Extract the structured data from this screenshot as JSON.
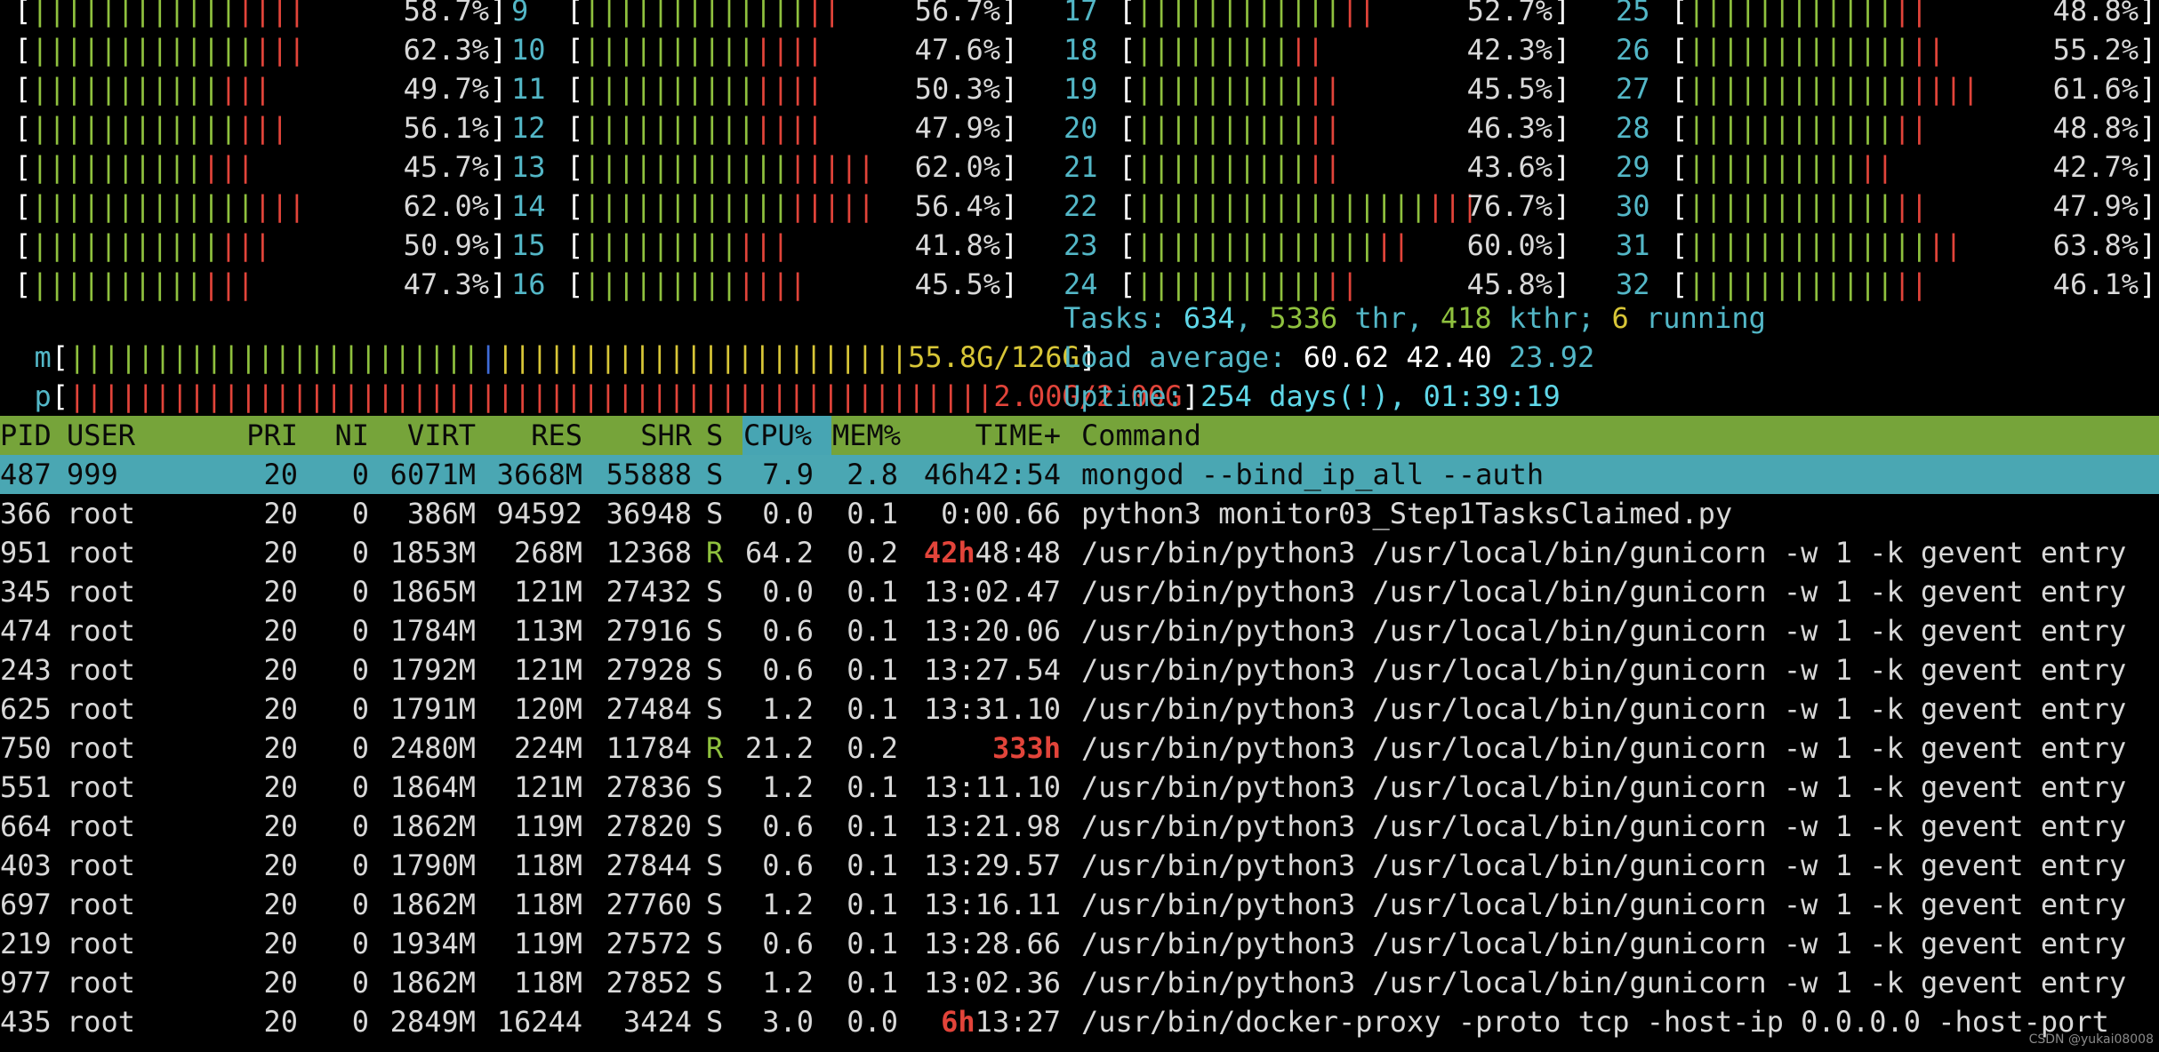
{
  "cpu_meters": [
    {
      "id": "",
      "bar": [
        12,
        4
      ],
      "pct": "58.7%"
    },
    {
      "id": "",
      "bar": [
        13,
        3
      ],
      "pct": "62.3%"
    },
    {
      "id": "",
      "bar": [
        11,
        3
      ],
      "pct": "49.7%"
    },
    {
      "id": "",
      "bar": [
        12,
        3
      ],
      "pct": "56.1%"
    },
    {
      "id": "",
      "bar": [
        10,
        3
      ],
      "pct": "45.7%"
    },
    {
      "id": "",
      "bar": [
        13,
        3
      ],
      "pct": "62.0%"
    },
    {
      "id": "",
      "bar": [
        11,
        3
      ],
      "pct": "50.9%"
    },
    {
      "id": "",
      "bar": [
        10,
        3
      ],
      "pct": "47.3%"
    },
    {
      "id": "9",
      "bar": [
        13,
        2
      ],
      "pct": "56.7%"
    },
    {
      "id": "10",
      "bar": [
        10,
        4
      ],
      "pct": "47.6%"
    },
    {
      "id": "11",
      "bar": [
        10,
        4
      ],
      "pct": "50.3%"
    },
    {
      "id": "12",
      "bar": [
        10,
        4
      ],
      "pct": "47.9%"
    },
    {
      "id": "13",
      "bar": [
        12,
        5
      ],
      "pct": "62.0%"
    },
    {
      "id": "14",
      "bar": [
        12,
        5
      ],
      "pct": "56.4%"
    },
    {
      "id": "15",
      "bar": [
        9,
        3
      ],
      "pct": "41.8%"
    },
    {
      "id": "16",
      "bar": [
        9,
        4
      ],
      "pct": "45.5%"
    },
    {
      "id": "17",
      "bar": [
        12,
        2
      ],
      "pct": "52.7%"
    },
    {
      "id": "18",
      "bar": [
        9,
        2
      ],
      "pct": "42.3%"
    },
    {
      "id": "19",
      "bar": [
        10,
        2
      ],
      "pct": "45.5%"
    },
    {
      "id": "20",
      "bar": [
        10,
        2
      ],
      "pct": "46.3%"
    },
    {
      "id": "21",
      "bar": [
        10,
        2
      ],
      "pct": "43.6%"
    },
    {
      "id": "22",
      "bar": [
        17,
        3
      ],
      "pct": "76.7%"
    },
    {
      "id": "23",
      "bar": [
        14,
        2
      ],
      "pct": "60.0%"
    },
    {
      "id": "24",
      "bar": [
        11,
        2
      ],
      "pct": "45.8%"
    },
    {
      "id": "25",
      "bar": [
        12,
        2
      ],
      "pct": "48.8%"
    },
    {
      "id": "26",
      "bar": [
        13,
        2
      ],
      "pct": "55.2%"
    },
    {
      "id": "27",
      "bar": [
        13,
        4
      ],
      "pct": "61.6%"
    },
    {
      "id": "28",
      "bar": [
        12,
        2
      ],
      "pct": "48.8%"
    },
    {
      "id": "29",
      "bar": [
        10,
        2
      ],
      "pct": "42.7%"
    },
    {
      "id": "30",
      "bar": [
        12,
        2
      ],
      "pct": "47.9%"
    },
    {
      "id": "31",
      "bar": [
        14,
        2
      ],
      "pct": "63.8%"
    },
    {
      "id": "32",
      "bar": [
        12,
        2
      ],
      "pct": "46.1%"
    }
  ],
  "mem_meter": {
    "label": "m",
    "bar": "||||||||||||||||||||||||||||||||||||||||||||||||||||",
    "value": "55.8G/126G"
  },
  "swp_meter": {
    "label": "p",
    "bar": "||||||||||||||||||||||||||||||||||||||||||||||||||||||||||||||||||||||||||",
    "value": "2.00G/2.00G"
  },
  "tasks": {
    "label": "Tasks: ",
    "count": "634",
    "sep1": ", ",
    "threads": "5336",
    "thr_label": " thr, ",
    "kthreads": "418",
    "kthr_label": " kthr; ",
    "running": "6",
    "running_label": " running"
  },
  "load": {
    "label": "Load average: ",
    "one": "60.62",
    "five": "42.40",
    "fifteen": "23.92"
  },
  "uptime": {
    "label": "Uptime: ",
    "value": "254 days(!), 01:39:19"
  },
  "columns": {
    "pid": "PID",
    "user": "USER",
    "pri": "PRI",
    "ni": "NI",
    "virt": "VIRT",
    "res": "RES",
    "shr": "SHR",
    "s": "S",
    "cpu": "CPU%",
    "mem": "MEM%",
    "time": "TIME+",
    "cmd": "Command"
  },
  "processes": [
    {
      "pid": "487",
      "user": "999",
      "pri": "20",
      "ni": "0",
      "virt": "6071M",
      "res": "3668M",
      "shr": "55888",
      "s": "S",
      "cpu": "7.9",
      "mem": "2.8",
      "time_hi": "",
      "time": "46h42:54",
      "cmd": "mongod --bind_ip_all --auth"
    },
    {
      "pid": "366",
      "user": "root",
      "pri": "20",
      "ni": "0",
      "virt": "386M",
      "res": "94592",
      "shr": "36948",
      "s": "S",
      "cpu": "0.0",
      "mem": "0.1",
      "time_hi": "",
      "time": "0:00.66",
      "cmd": "python3 monitor03_Step1TasksClaimed.py"
    },
    {
      "pid": "951",
      "user": "root",
      "pri": "20",
      "ni": "0",
      "virt": "1853M",
      "res": "268M",
      "shr": "12368",
      "s": "R",
      "cpu": "64.2",
      "mem": "0.2",
      "time_hi": "42h",
      "time": "48:48",
      "cmd": "/usr/bin/python3 /usr/local/bin/gunicorn -w 1 -k gevent entry"
    },
    {
      "pid": "345",
      "user": "root",
      "pri": "20",
      "ni": "0",
      "virt": "1865M",
      "res": "121M",
      "shr": "27432",
      "s": "S",
      "cpu": "0.0",
      "mem": "0.1",
      "time_hi": "",
      "time": "13:02.47",
      "cmd": "/usr/bin/python3 /usr/local/bin/gunicorn -w 1 -k gevent entry"
    },
    {
      "pid": "474",
      "user": "root",
      "pri": "20",
      "ni": "0",
      "virt": "1784M",
      "res": "113M",
      "shr": "27916",
      "s": "S",
      "cpu": "0.6",
      "mem": "0.1",
      "time_hi": "",
      "time": "13:20.06",
      "cmd": "/usr/bin/python3 /usr/local/bin/gunicorn -w 1 -k gevent entry"
    },
    {
      "pid": "243",
      "user": "root",
      "pri": "20",
      "ni": "0",
      "virt": "1792M",
      "res": "121M",
      "shr": "27928",
      "s": "S",
      "cpu": "0.6",
      "mem": "0.1",
      "time_hi": "",
      "time": "13:27.54",
      "cmd": "/usr/bin/python3 /usr/local/bin/gunicorn -w 1 -k gevent entry"
    },
    {
      "pid": "625",
      "user": "root",
      "pri": "20",
      "ni": "0",
      "virt": "1791M",
      "res": "120M",
      "shr": "27484",
      "s": "S",
      "cpu": "1.2",
      "mem": "0.1",
      "time_hi": "",
      "time": "13:31.10",
      "cmd": "/usr/bin/python3 /usr/local/bin/gunicorn -w 1 -k gevent entry"
    },
    {
      "pid": "750",
      "user": "root",
      "pri": "20",
      "ni": "0",
      "virt": "2480M",
      "res": "224M",
      "shr": "11784",
      "s": "R",
      "cpu": "21.2",
      "mem": "0.2",
      "time_hi": "333h",
      "time": "",
      "cmd": "/usr/bin/python3 /usr/local/bin/gunicorn -w 1 -k gevent entry"
    },
    {
      "pid": "551",
      "user": "root",
      "pri": "20",
      "ni": "0",
      "virt": "1864M",
      "res": "121M",
      "shr": "27836",
      "s": "S",
      "cpu": "1.2",
      "mem": "0.1",
      "time_hi": "",
      "time": "13:11.10",
      "cmd": "/usr/bin/python3 /usr/local/bin/gunicorn -w 1 -k gevent entry"
    },
    {
      "pid": "664",
      "user": "root",
      "pri": "20",
      "ni": "0",
      "virt": "1862M",
      "res": "119M",
      "shr": "27820",
      "s": "S",
      "cpu": "0.6",
      "mem": "0.1",
      "time_hi": "",
      "time": "13:21.98",
      "cmd": "/usr/bin/python3 /usr/local/bin/gunicorn -w 1 -k gevent entry"
    },
    {
      "pid": "403",
      "user": "root",
      "pri": "20",
      "ni": "0",
      "virt": "1790M",
      "res": "118M",
      "shr": "27844",
      "s": "S",
      "cpu": "0.6",
      "mem": "0.1",
      "time_hi": "",
      "time": "13:29.57",
      "cmd": "/usr/bin/python3 /usr/local/bin/gunicorn -w 1 -k gevent entry"
    },
    {
      "pid": "697",
      "user": "root",
      "pri": "20",
      "ni": "0",
      "virt": "1862M",
      "res": "118M",
      "shr": "27760",
      "s": "S",
      "cpu": "1.2",
      "mem": "0.1",
      "time_hi": "",
      "time": "13:16.11",
      "cmd": "/usr/bin/python3 /usr/local/bin/gunicorn -w 1 -k gevent entry"
    },
    {
      "pid": "219",
      "user": "root",
      "pri": "20",
      "ni": "0",
      "virt": "1934M",
      "res": "119M",
      "shr": "27572",
      "s": "S",
      "cpu": "0.6",
      "mem": "0.1",
      "time_hi": "",
      "time": "13:28.66",
      "cmd": "/usr/bin/python3 /usr/local/bin/gunicorn -w 1 -k gevent entry"
    },
    {
      "pid": "977",
      "user": "root",
      "pri": "20",
      "ni": "0",
      "virt": "1862M",
      "res": "118M",
      "shr": "27852",
      "s": "S",
      "cpu": "1.2",
      "mem": "0.1",
      "time_hi": "",
      "time": "13:02.36",
      "cmd": "/usr/bin/python3 /usr/local/bin/gunicorn -w 1 -k gevent entry"
    },
    {
      "pid": "435",
      "user": "root",
      "pri": "20",
      "ni": "0",
      "virt": "2849M",
      "res": "16244",
      "shr": "3424",
      "s": "S",
      "cpu": "3.0",
      "mem": "0.0",
      "time_hi": "6h",
      "time": "13:27",
      "cmd": "/usr/bin/docker-proxy -proto tcp -host-ip 0.0.0.0 -host-port"
    }
  ],
  "watermark": "CSDN @yukai08008",
  "colors": {
    "header_bg": "#76a43a",
    "selected_bg": "#4aa7b3",
    "sort_col_bg": "#47a5b3",
    "bar_green": "#8fc13e",
    "bar_red": "#e2443a",
    "label_cyan": "#53b7c7"
  }
}
